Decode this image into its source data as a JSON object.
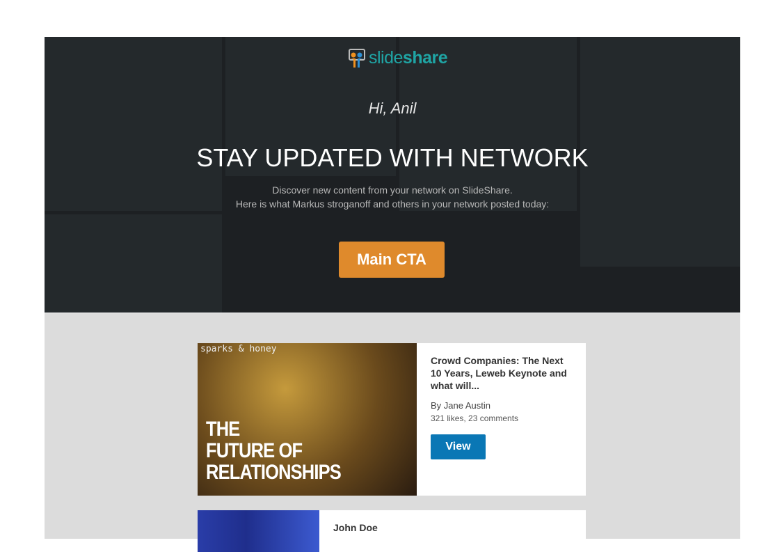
{
  "header": {
    "logo_text_a": "slide",
    "logo_text_b": "share",
    "greeting": "Hi, Anil",
    "title": "STAY UPDATED WITH NETWORK",
    "subtitle_line1": "Discover new content from your network on SlideShare.",
    "subtitle_line2": "Here is what Markus stroganoff and others in your network posted today:",
    "cta_label": "Main CTA"
  },
  "cards": [
    {
      "thumb_brand": "sparks & honey",
      "thumb_text": "THE FUTURE OF RELATIONSHIPS",
      "title": "Crowd Companies: The Next 10 Years, Leweb Keynote and what will...",
      "author": "By Jane Austin",
      "stats": "321 likes, 23 comments",
      "button": "View"
    },
    {
      "author": "John Doe"
    }
  ],
  "colors": {
    "cta": "#df8a2c",
    "view": "#0a77b5",
    "brand": "#1fa5a5"
  }
}
